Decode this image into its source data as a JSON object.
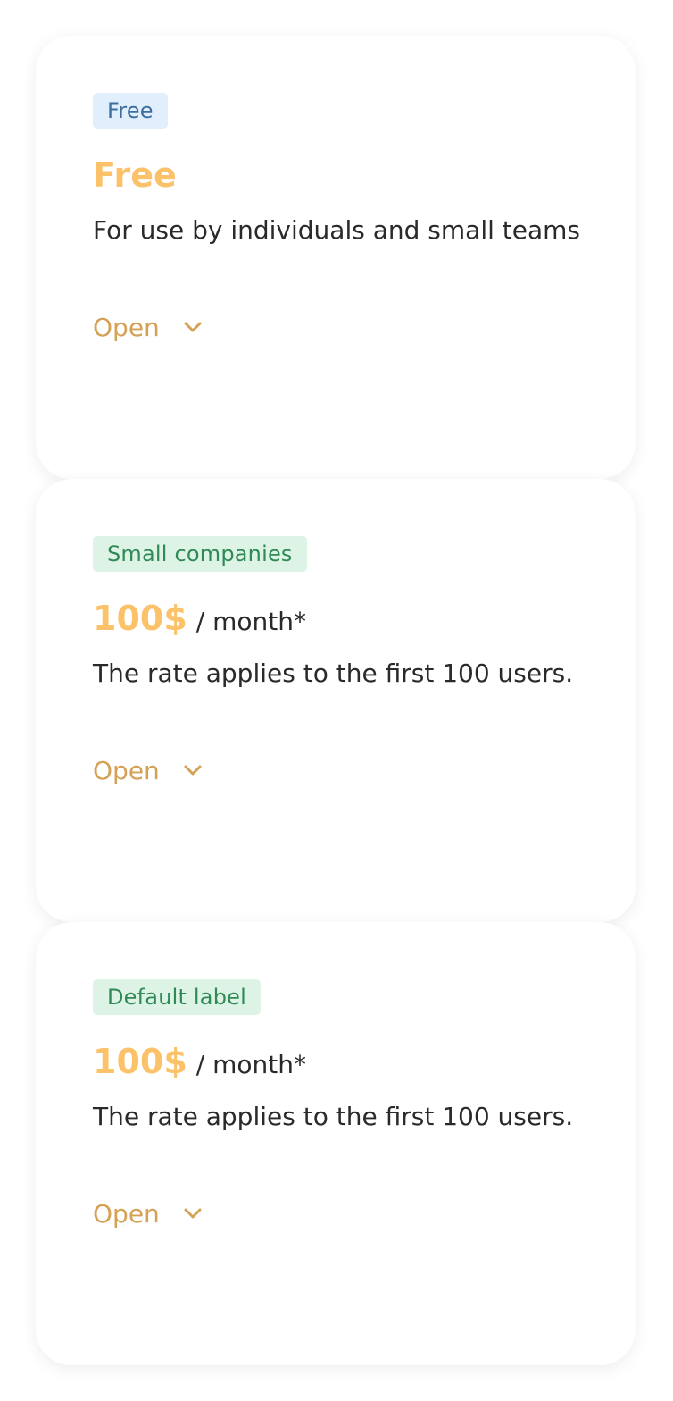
{
  "plans": [
    {
      "badge": "Free",
      "price": "Free",
      "period": "",
      "description": "For use by individuals and small teams",
      "toggle_label": "Open"
    },
    {
      "badge": "Small companies",
      "price": "100$",
      "period": "/ month*",
      "description": "The rate applies to the first 100 users.",
      "toggle_label": "Open"
    },
    {
      "badge": "Default label",
      "price": "100$",
      "period": "/ month*",
      "description": "The rate applies to the first 100 users.",
      "toggle_label": "Open"
    }
  ],
  "icons": {
    "toggle": "chevron-down-icon"
  },
  "colors": {
    "price": "#fbc26a",
    "toggle": "#d4a155",
    "badge_blue_bg": "#e1eefb",
    "badge_blue_text": "#3d6f9e",
    "badge_green_bg": "#ddf3e6",
    "badge_green_text": "#2f8a55"
  }
}
